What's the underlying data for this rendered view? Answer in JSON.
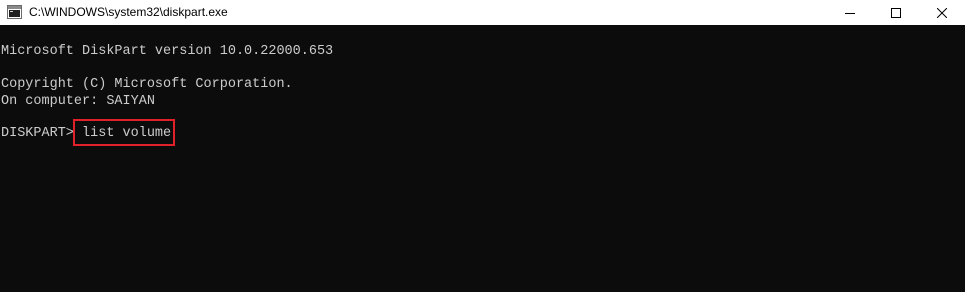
{
  "window": {
    "title": "C:\\WINDOWS\\system32\\diskpart.exe",
    "icon": "console-app-icon",
    "controls": {
      "minimize": "minimize-icon",
      "maximize": "maximize-icon",
      "close": "close-icon"
    }
  },
  "console": {
    "version_line": "Microsoft DiskPart version 10.0.22000.653",
    "copyright_line": "Copyright (C) Microsoft Corporation.",
    "computer_line": "On computer: SAIYAN",
    "prompt": "DISKPART> ",
    "command": "list volume"
  },
  "colors": {
    "console_background": "#0c0c0c",
    "console_text": "#cccccc",
    "titlebar_background": "#ffffff",
    "highlight_border": "#e0212a"
  }
}
